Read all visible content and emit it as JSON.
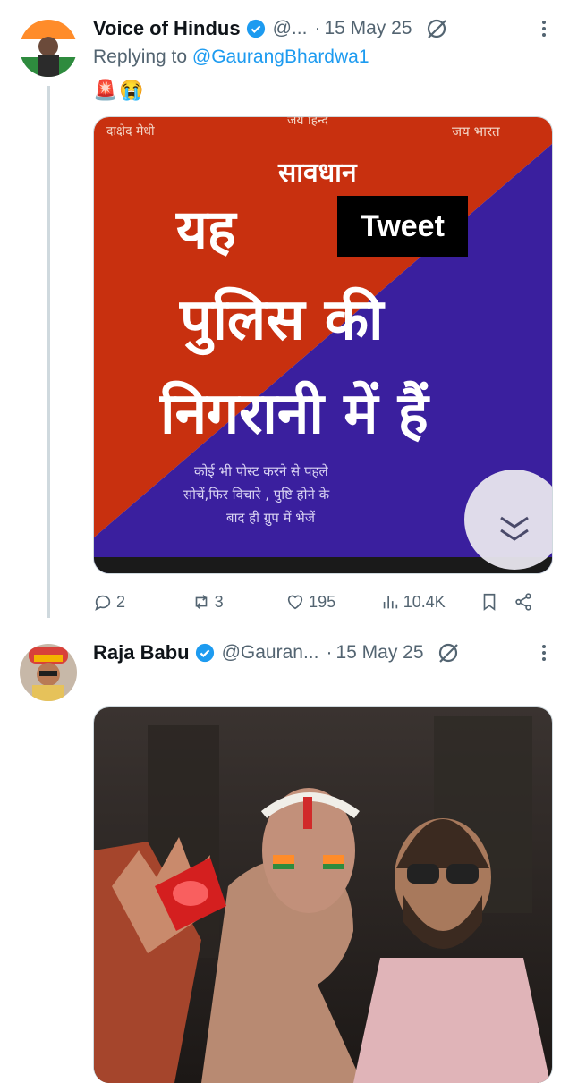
{
  "tweet1": {
    "name": "Voice of Hindus",
    "handle": "@...",
    "dot": "·",
    "date": "15 May 25",
    "reply_prefix": "Replying to ",
    "reply_mention": "@GaurangBhardwa1",
    "emoji1": "🚨",
    "emoji2": "😭",
    "image": {
      "top_left": "दाक्षेद मेधी",
      "top_center": "जय हिन्द",
      "top_right": "जय भारत",
      "line1": "सावधान",
      "line2": "यह",
      "line3": "पुलिस की",
      "line4": "निगरानी में हैं",
      "small1": "कोई भी पोस्ट करने से पहले",
      "small2": "सोचें,फिर विचारे , पुष्टि होने के",
      "small3": "बाद ही ग्रुप में भेजें",
      "overlay_label": "Tweet"
    },
    "actions": {
      "replies": "2",
      "reposts": "3",
      "likes": "195",
      "views": "10.4K"
    }
  },
  "tweet2": {
    "name": "Raja Babu",
    "handle": "@Gauran...",
    "dot": "·",
    "date": "15 May 25"
  },
  "colors": {
    "accent": "#1d9bf0",
    "muted": "#536471",
    "text": "#0f1419",
    "thread_line": "#cfd9de",
    "poster_red": "#c8300f",
    "poster_blue": "#3a1f9e"
  }
}
